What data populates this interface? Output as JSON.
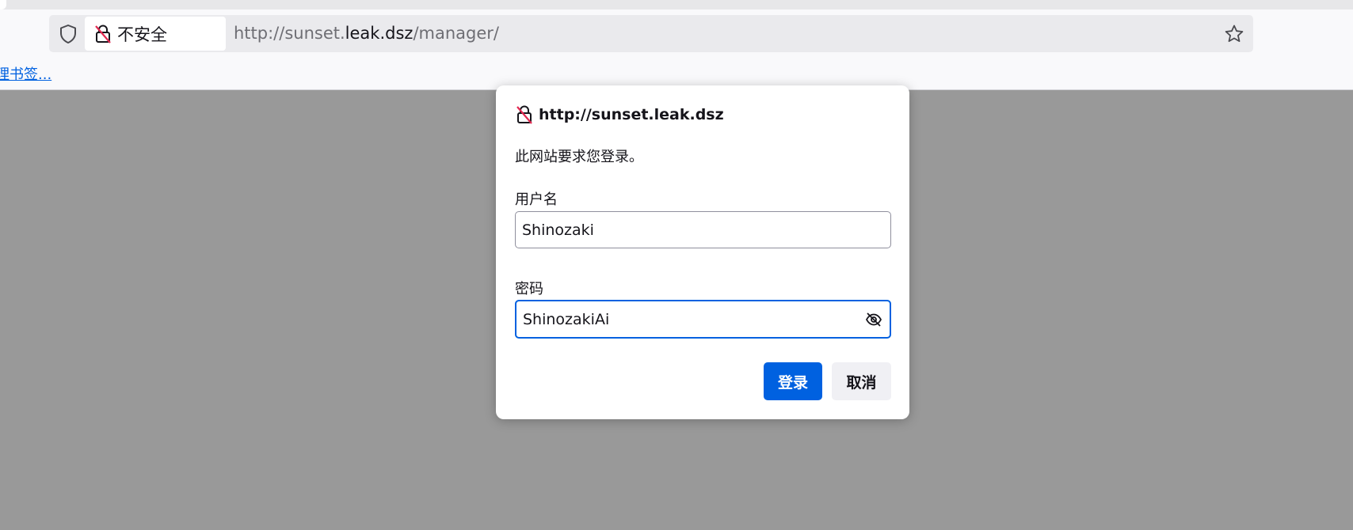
{
  "urlbar": {
    "insecure_label": "不安全",
    "url_prefix": "http://sunset.",
    "url_host": "leak.dsz",
    "url_path": "/manager/"
  },
  "bookmarks": {
    "manage_link": "理书签..."
  },
  "dialog": {
    "host": "http://sunset.leak.dsz",
    "message": "此网站要求您登录。",
    "username_label": "用户名",
    "username_value": "Shinozaki",
    "password_label": "密码",
    "password_value": "ShinozakiAi",
    "login_button": "登录",
    "cancel_button": "取消"
  },
  "icons": {
    "shield": "shield-icon",
    "insecure_lock": "insecure-lock-icon",
    "star": "bookmark-star-icon",
    "eye_hidden": "eye-slash-icon"
  },
  "colors": {
    "accent": "#0061e0",
    "insecure_red": "#e22850",
    "overlay": "#999999"
  }
}
